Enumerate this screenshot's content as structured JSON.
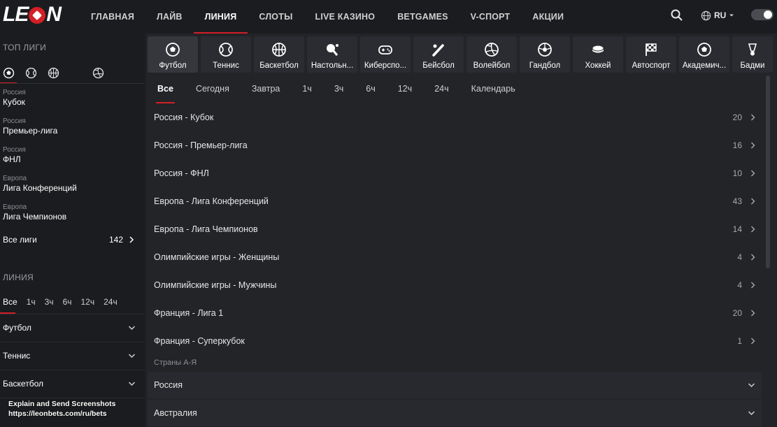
{
  "brand": {
    "logo_left": "LE",
    "logo_right": "N"
  },
  "nav": [
    {
      "label": "ГЛАВНАЯ",
      "active": false
    },
    {
      "label": "ЛАЙВ",
      "active": false
    },
    {
      "label": "ЛИНИЯ",
      "active": true
    },
    {
      "label": "СЛОТЫ",
      "active": false
    },
    {
      "label": "LIVE КАЗИНО",
      "active": false
    },
    {
      "label": "BETGAMES",
      "active": false
    },
    {
      "label": "V-СПОРТ",
      "active": false
    },
    {
      "label": "АКЦИИ",
      "active": false
    }
  ],
  "header": {
    "lang": "RU"
  },
  "sidebar": {
    "top_leagues_title": "ТОП ЛИГИ",
    "top_icons": [
      "football-icon",
      "tennis-icon",
      "basketball-icon",
      "esports-icon",
      "volleyball-icon"
    ],
    "leagues": [
      {
        "country": "Россия",
        "name": "Кубок"
      },
      {
        "country": "Россия",
        "name": "Премьер-лига"
      },
      {
        "country": "Россия",
        "name": "ФНЛ"
      },
      {
        "country": "Европа",
        "name": "Лига Конференций"
      },
      {
        "country": "Европа",
        "name": "Лига Чемпионов"
      }
    ],
    "all_leagues": {
      "label": "Все лиги",
      "count": "142"
    },
    "line_title": "ЛИНИЯ",
    "line_tabs": [
      {
        "label": "Все",
        "active": true
      },
      {
        "label": "1ч",
        "active": false
      },
      {
        "label": "3ч",
        "active": false
      },
      {
        "label": "6ч",
        "active": false
      },
      {
        "label": "12ч",
        "active": false
      },
      {
        "label": "24ч",
        "active": false
      }
    ],
    "sports": [
      "Футбол",
      "Теннис",
      "Баскетбол"
    ]
  },
  "tooltip": {
    "line1": "Explain and Send Screenshots",
    "line2": "https://leonbets.com/ru/bets"
  },
  "sports_bar": [
    {
      "label": "Футбол",
      "icon": "football-icon",
      "active": true
    },
    {
      "label": "Теннис",
      "icon": "tennis-icon",
      "active": false
    },
    {
      "label": "Баскетбол",
      "icon": "basketball-icon",
      "active": false
    },
    {
      "label": "Настольн...",
      "icon": "table-tennis-icon",
      "active": false
    },
    {
      "label": "Киберспо...",
      "icon": "gamepad-icon",
      "active": false
    },
    {
      "label": "Бейсбол",
      "icon": "baseball-icon",
      "active": false
    },
    {
      "label": "Волейбол",
      "icon": "volleyball-icon",
      "active": false
    },
    {
      "label": "Гандбол",
      "icon": "handball-icon",
      "active": false
    },
    {
      "label": "Хоккей",
      "icon": "hockey-puck-icon",
      "active": false
    },
    {
      "label": "Автоспорт",
      "icon": "checkered-flag-icon",
      "active": false
    },
    {
      "label": "Академич...",
      "icon": "academic-football-icon",
      "active": false
    },
    {
      "label": "Бадми",
      "icon": "badminton-icon",
      "active": false
    }
  ],
  "time_tabs": [
    {
      "label": "Все",
      "active": true
    },
    {
      "label": "Сегодня",
      "active": false
    },
    {
      "label": "Завтра",
      "active": false
    },
    {
      "label": "1ч",
      "active": false
    },
    {
      "label": "3ч",
      "active": false
    },
    {
      "label": "6ч",
      "active": false
    },
    {
      "label": "12ч",
      "active": false
    },
    {
      "label": "24ч",
      "active": false
    },
    {
      "label": "Календарь",
      "active": false
    }
  ],
  "league_rows": [
    {
      "name": "Россия - Кубок",
      "count": "20"
    },
    {
      "name": "Россия - Премьер-лига",
      "count": "16"
    },
    {
      "name": "Россия - ФНЛ",
      "count": "10"
    },
    {
      "name": "Европа - Лига Конференций",
      "count": "43"
    },
    {
      "name": "Европа - Лига Чемпионов",
      "count": "14"
    },
    {
      "name": "Олимпийские игры - Женщины",
      "count": "4"
    },
    {
      "name": "Олимпийские игры - Мужчины",
      "count": "4"
    },
    {
      "name": "Франция - Лига 1",
      "count": "20"
    },
    {
      "name": "Франция - Суперкубок",
      "count": "1"
    }
  ],
  "countries_title": "Страны А-Я",
  "countries": [
    "Россия",
    "Австралия"
  ],
  "colors": {
    "accent": "#d31f26",
    "bg": "#1e1f22",
    "panel": "#1b1c1f",
    "main": "#232428"
  }
}
